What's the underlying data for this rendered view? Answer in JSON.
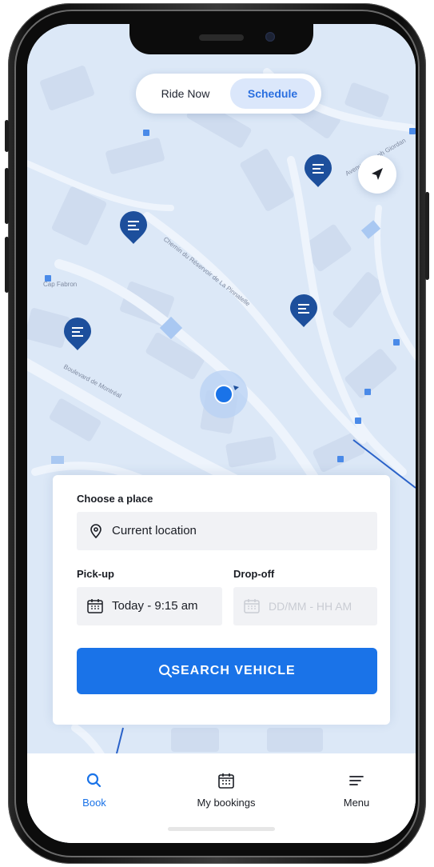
{
  "toggle": {
    "ride_now": "Ride Now",
    "schedule": "Schedule",
    "selected": "Schedule"
  },
  "map": {
    "street_labels": [
      "Cap Fabron",
      "Chemin du Réservoir de La Pinnatelle",
      "Avenue Joseph Giordan",
      "Boulevard de Montréal"
    ]
  },
  "booking": {
    "place_label": "Choose a place",
    "place_value": "Current location",
    "pickup_label": "Pick-up",
    "pickup_value": "Today - 9:15 am",
    "dropoff_label": "Drop-off",
    "dropoff_placeholder": "DD/MM - HH AM",
    "search_label": "SEARCH VEHICLE"
  },
  "tabs": [
    {
      "label": "Book",
      "icon": "search-icon",
      "active": true
    },
    {
      "label": "My bookings",
      "icon": "calendar-icon",
      "active": false
    },
    {
      "label": "Menu",
      "icon": "menu-icon",
      "active": false
    }
  ],
  "colors": {
    "accent": "#1a73e8",
    "map_bg": "#dce8f7",
    "pin": "#1d4f9c",
    "selected_segment_bg": "#dbe7fb"
  }
}
